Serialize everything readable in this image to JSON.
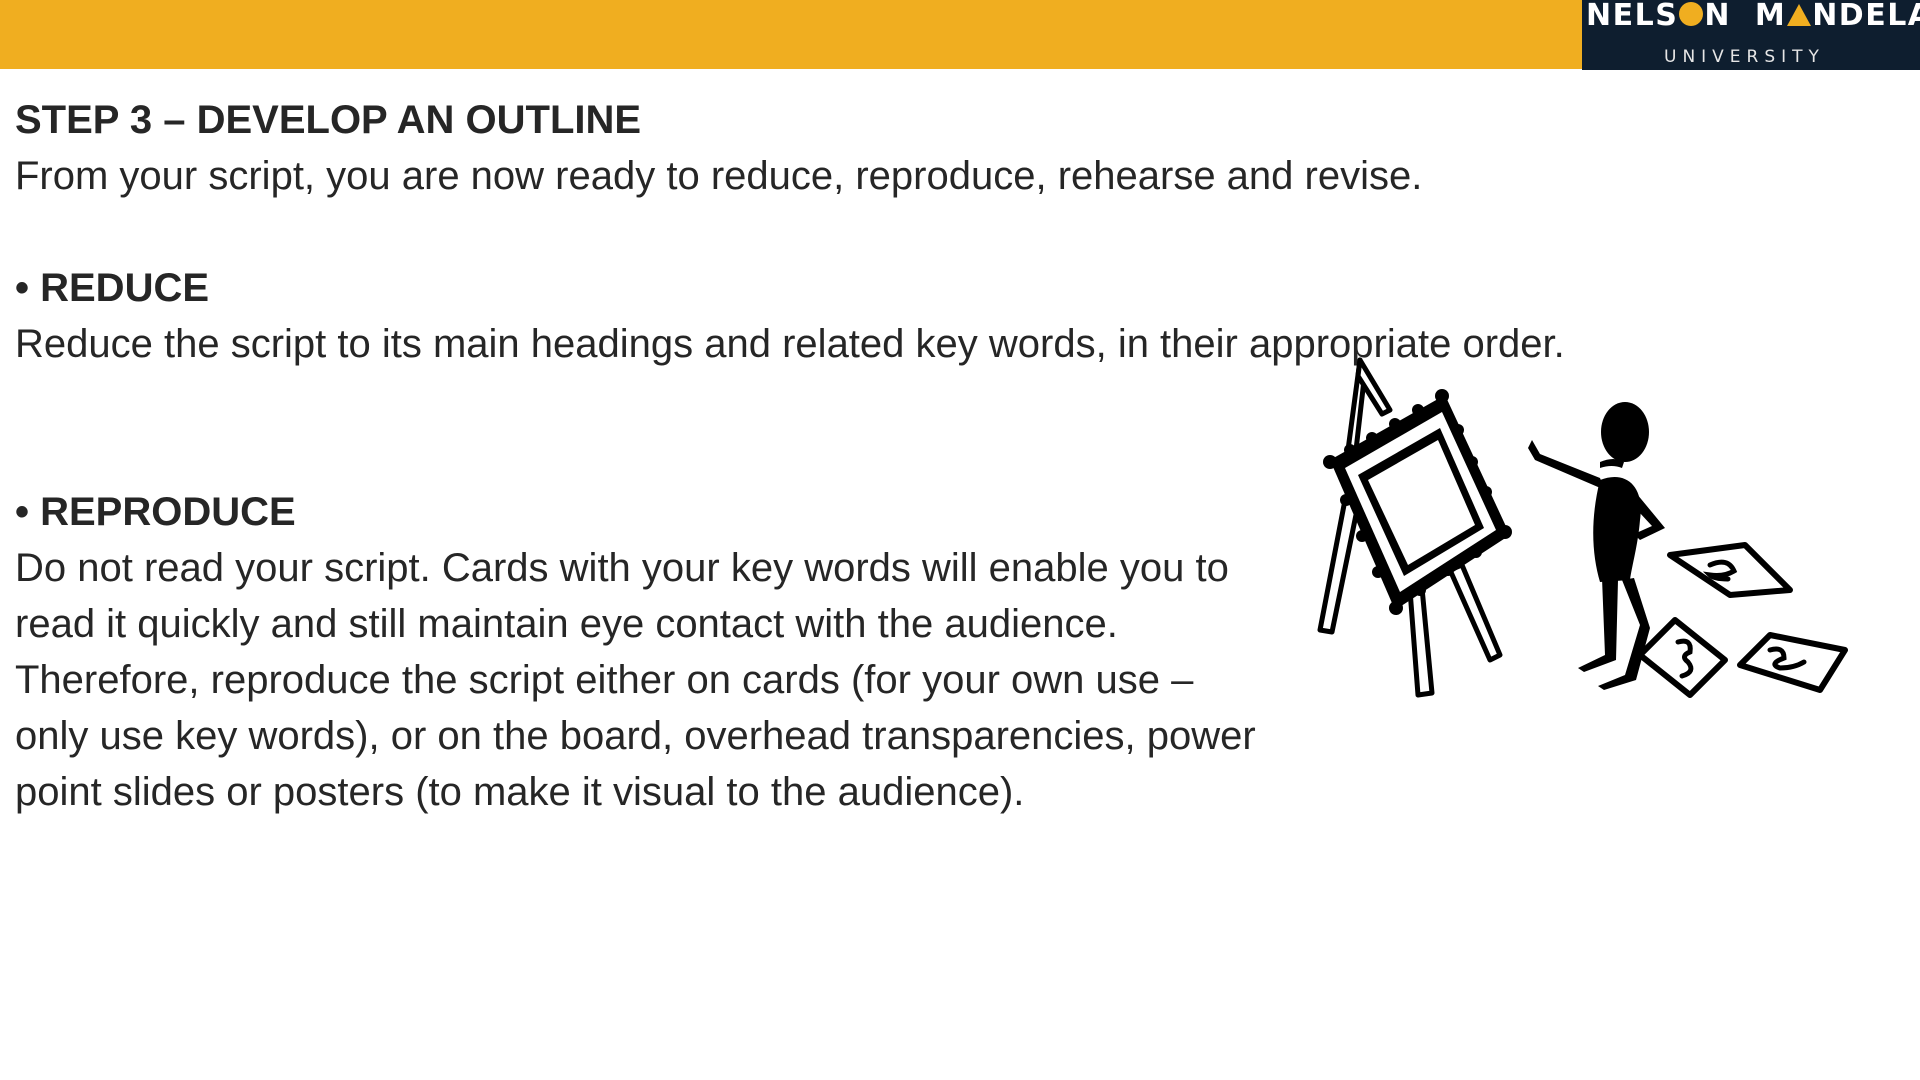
{
  "brand": {
    "bar_color": "#f0ae20",
    "logo_bg": "#0e1e2f",
    "logo_accent": "#f0ae20",
    "logo_part1": "NELS",
    "logo_part2": "N",
    "logo_part3": "M",
    "logo_part4": "NDELA",
    "logo_subtitle": "UNIVERSITY"
  },
  "slide": {
    "title": "STEP 3 – DEVELOP AN OUTLINE",
    "intro": "From your script, you are now ready to reduce, reproduce, rehearse and revise.",
    "sections": [
      {
        "heading": "• REDUCE",
        "body": "Reduce the script to its main headings and related key words, in their appropriate order."
      },
      {
        "heading": "• REPRODUCE",
        "body": "Do not read your script. Cards with your key words will enable you to read it quickly and still maintain eye contact with the audience. Therefore, reproduce the script either on cards (for your own use – only use key words), or on the board, overhead transparencies, power point slides or posters (to make it visual to the audience)."
      }
    ],
    "illustration_icon": "presenter-easel-illustration"
  }
}
